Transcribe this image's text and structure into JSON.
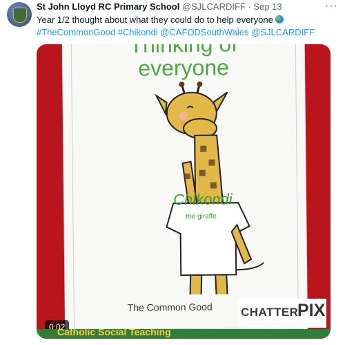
{
  "tweet": {
    "author_name": "St John Lloyd RC Primary School",
    "handle_date": "@SJLCARDIFF · Sep 13",
    "more_icon": "more-icon",
    "text_line1": "Year 1/2 thought about what they could do to help everyone",
    "text_line2": "#TheCommonGood #Chikondi @CAFODSouthWales @SJLCARDIFF"
  },
  "media": {
    "heading_line1": "Thinking of",
    "heading_line2": "everyone",
    "tshirt_name": "Chikondi",
    "tshirt_sub": "the giraffe",
    "footer": "The Common Good",
    "watermark_left": "CHATTER",
    "watermark_right": "PIX",
    "video_time": "0:02",
    "bottom_banner": "Catholic Social Teaching"
  },
  "colors": {
    "link": "#1d9bf0",
    "poster_green": "#4ea644",
    "background_red": "#b8151c"
  }
}
